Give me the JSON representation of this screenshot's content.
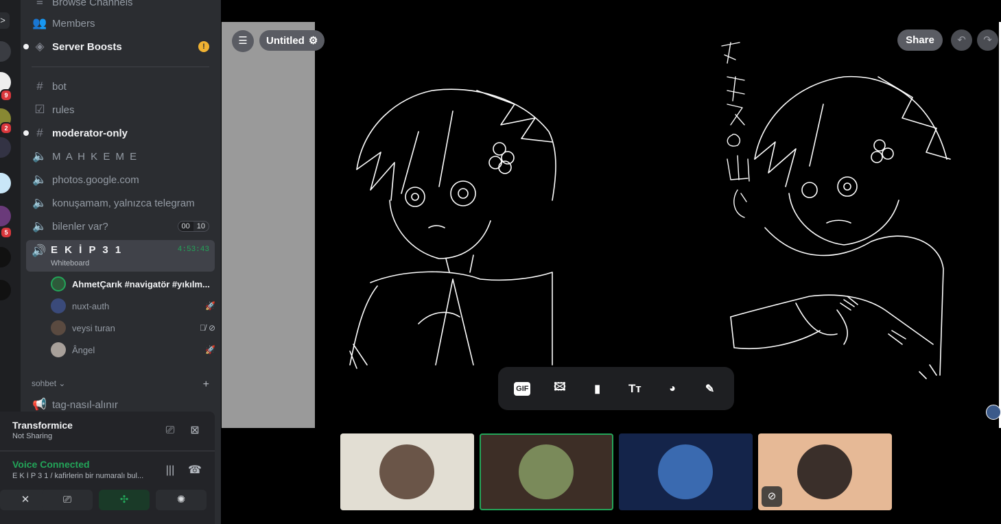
{
  "rail": {
    "badges": [
      "9",
      "2",
      "5"
    ],
    "toggle": ">"
  },
  "sidebar": {
    "browse": "Browse Channels",
    "members": "Members",
    "boosts": "Server Boosts",
    "boosts_alert": "!",
    "channels": [
      {
        "label": "bot"
      },
      {
        "label": "rules"
      },
      {
        "label": "moderator-only"
      },
      {
        "label": "M A H K E M E"
      },
      {
        "label": "photos.google.com"
      },
      {
        "label": "konuşamam, yalnızca telegram"
      },
      {
        "label": "bilenler var?"
      }
    ],
    "counter": [
      "00",
      "10"
    ],
    "active": {
      "name": "E K İ P 3 1",
      "sub": "Whiteboard",
      "time": "4:53:43"
    },
    "voice_users": [
      {
        "name": "AhmetÇarık #navigatör #yıkılm..."
      },
      {
        "name": "nuxt-auth"
      },
      {
        "name": "veysi turan"
      },
      {
        "name": "Ângel"
      }
    ],
    "category": "sohbet",
    "category_chevron": "⌄",
    "category_add": "+",
    "after_category": "tag-nasıl-alınır"
  },
  "panel": {
    "share_title": "Transformice",
    "share_sub": "Not Sharing",
    "voice_title": "Voice Connected",
    "voice_sub": "E K İ P 3 1 / kafirlerin bir numaralı bul..."
  },
  "whiteboard": {
    "title": "Untitled",
    "share": "Share",
    "tools": [
      "GIF",
      "Tт"
    ]
  },
  "colors": {
    "accent_green": "#23a559",
    "sidebar": "#2b2d31",
    "panel": "#232428"
  }
}
